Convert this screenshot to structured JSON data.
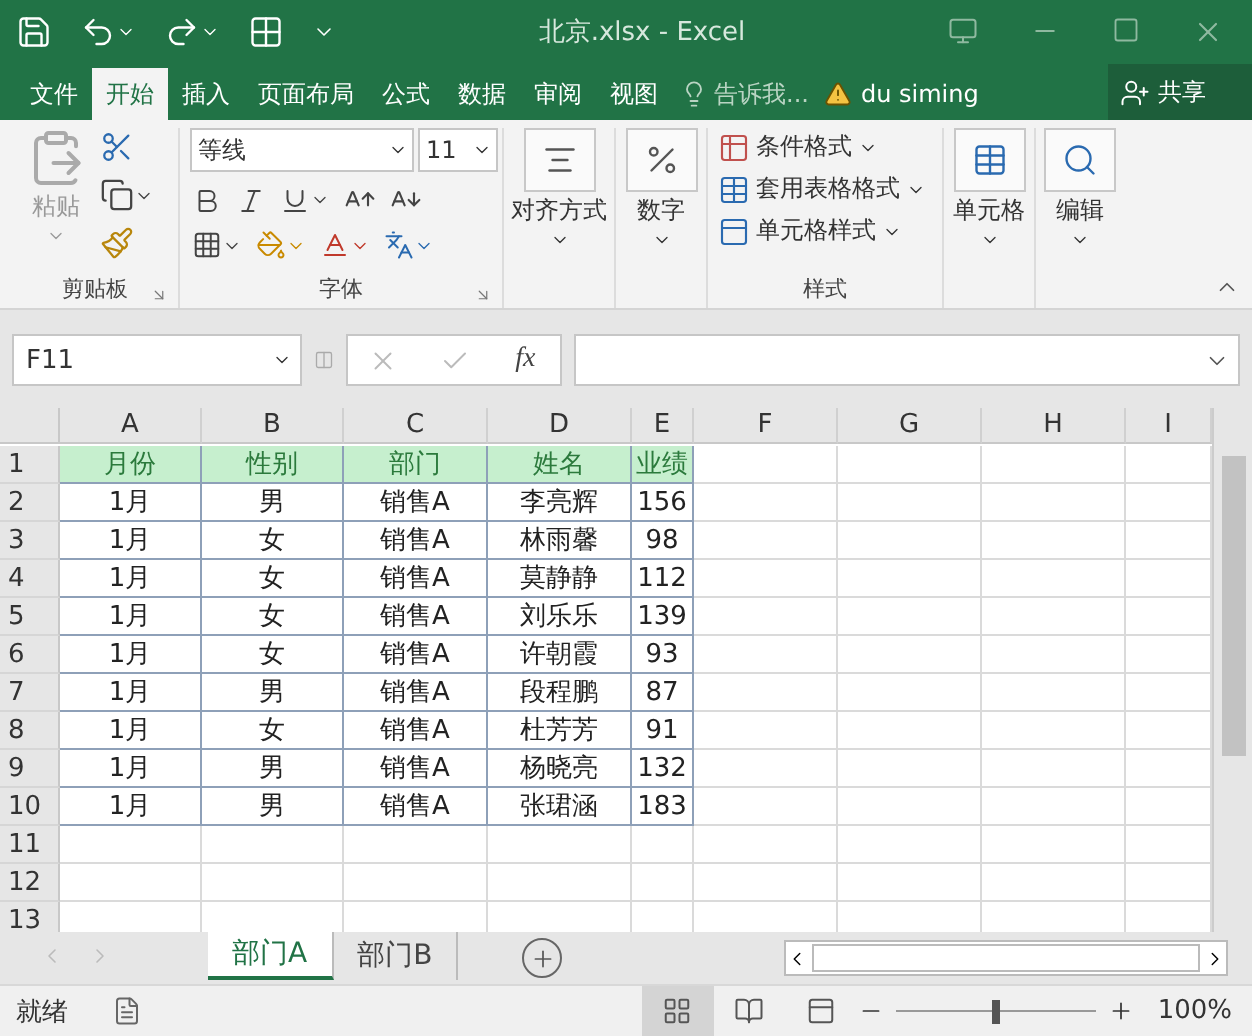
{
  "window": {
    "title": "北京.xlsx - Excel"
  },
  "ribbon_tabs": [
    {
      "label": "文件",
      "selected": false
    },
    {
      "label": "开始",
      "selected": true
    },
    {
      "label": "插入",
      "selected": false
    },
    {
      "label": "页面布局",
      "selected": false
    },
    {
      "label": "公式",
      "selected": false
    },
    {
      "label": "数据",
      "selected": false
    },
    {
      "label": "审阅",
      "selected": false
    },
    {
      "label": "视图",
      "selected": false
    }
  ],
  "tell_me": {
    "placeholder": "告诉我..."
  },
  "user": "du siming",
  "share": "共享",
  "clipboard": {
    "paste": "粘贴",
    "label": "剪贴板"
  },
  "font": {
    "name": "等线",
    "size": "11",
    "label": "字体"
  },
  "alignment": {
    "label": "对齐方式"
  },
  "number": {
    "label": "数字"
  },
  "styles": {
    "items": [
      "条件格式",
      "套用表格格式",
      "单元格样式"
    ],
    "label": "样式"
  },
  "cells": {
    "label": "单元格"
  },
  "editing": {
    "label": "编辑"
  },
  "formula_bar": {
    "name_box": "F11",
    "function_button": "fx"
  },
  "sheet": {
    "columns": [
      "A",
      "B",
      "C",
      "D",
      "E",
      "F",
      "G",
      "H",
      "I"
    ],
    "rows": [
      {
        "number": "1",
        "kind": "header",
        "cells": [
          "月份",
          "性别",
          "部门",
          "姓名",
          "业绩"
        ]
      },
      {
        "number": "2",
        "kind": "data",
        "cells": [
          "1月",
          "男",
          "销售A",
          "李亮辉",
          "156"
        ]
      },
      {
        "number": "3",
        "kind": "data",
        "cells": [
          "1月",
          "女",
          "销售A",
          "林雨馨",
          "98"
        ]
      },
      {
        "number": "4",
        "kind": "data",
        "cells": [
          "1月",
          "女",
          "销售A",
          "莫静静",
          "112"
        ]
      },
      {
        "number": "5",
        "kind": "data",
        "cells": [
          "1月",
          "女",
          "销售A",
          "刘乐乐",
          "139"
        ]
      },
      {
        "number": "6",
        "kind": "data",
        "cells": [
          "1月",
          "女",
          "销售A",
          "许朝霞",
          "93"
        ]
      },
      {
        "number": "7",
        "kind": "data",
        "cells": [
          "1月",
          "男",
          "销售A",
          "段程鹏",
          "87"
        ]
      },
      {
        "number": "8",
        "kind": "data",
        "cells": [
          "1月",
          "女",
          "销售A",
          "杜芳芳",
          "91"
        ]
      },
      {
        "number": "9",
        "kind": "data",
        "cells": [
          "1月",
          "男",
          "销售A",
          "杨晓亮",
          "132"
        ]
      },
      {
        "number": "10",
        "kind": "data",
        "cells": [
          "1月",
          "男",
          "销售A",
          "张珺涵",
          "183"
        ]
      },
      {
        "number": "11",
        "kind": "empty"
      },
      {
        "number": "12",
        "kind": "empty"
      },
      {
        "number": "13",
        "kind": "empty"
      }
    ]
  },
  "sheet_tabs": [
    {
      "label": "部门A",
      "selected": true
    },
    {
      "label": "部门B",
      "selected": false
    }
  ],
  "status_bar": {
    "status": "就绪",
    "zoom_slider": {
      "level": 0.5
    },
    "zoom": "100%"
  }
}
